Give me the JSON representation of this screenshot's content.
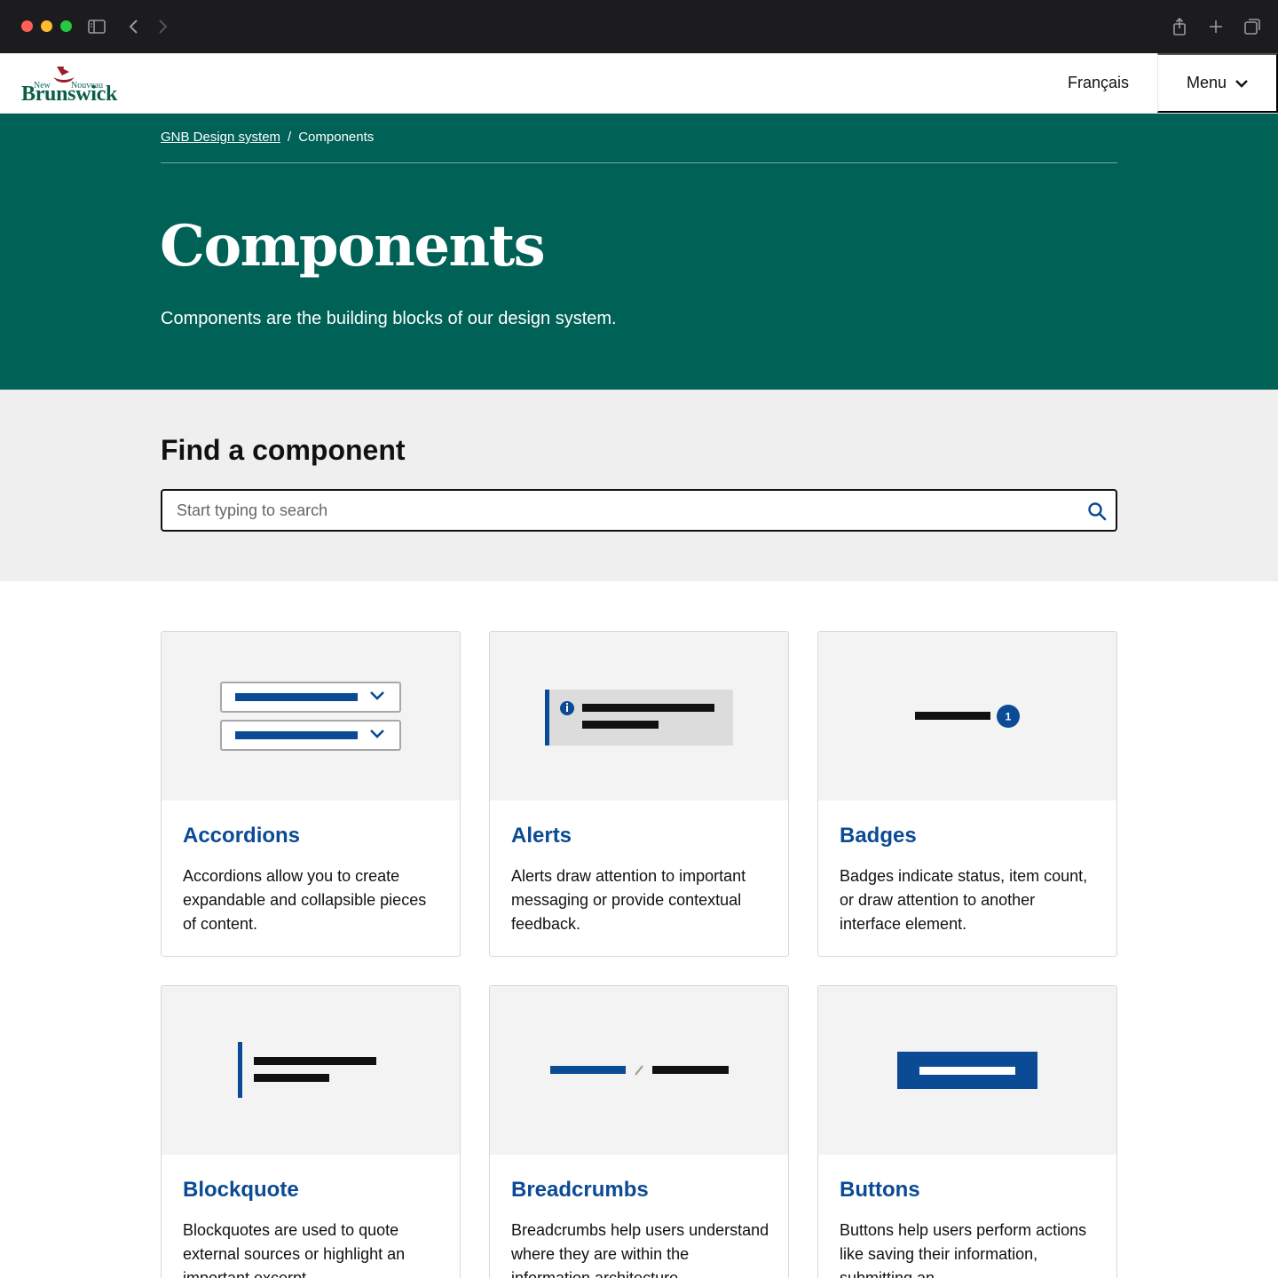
{
  "header": {
    "logo_new": "New",
    "logo_nouveau": "Nouveau",
    "logo_name": "Brunswick",
    "language_link": "Français",
    "menu_label": "Menu"
  },
  "breadcrumb": {
    "home": "GNB Design system",
    "separator": "/",
    "current": "Components"
  },
  "hero": {
    "title": "Components",
    "lead": "Components are the building blocks of our design system."
  },
  "search": {
    "heading": "Find a component",
    "placeholder": "Start typing to search"
  },
  "cards": [
    {
      "title": "Accordions",
      "description": "Accordions allow you to create expandable and collapsible pieces of content."
    },
    {
      "title": "Alerts",
      "description": "Alerts draw attention to important messaging or provide contextual feedback."
    },
    {
      "title": "Badges",
      "description": "Badges indicate status, item count, or draw attention to another interface element."
    },
    {
      "title": "Blockquote",
      "description": "Blockquotes are used to quote external sources or highlight an important excerpt."
    },
    {
      "title": "Breadcrumbs",
      "description": "Breadcrumbs help users understand where they are within the information architecture."
    },
    {
      "title": "Buttons",
      "description": "Buttons help users perform actions like saving their information, submitting an"
    }
  ],
  "badge_count": "1",
  "colors": {
    "hero_bg": "#006156",
    "link_blue": "#0b4a94",
    "accent_blue": "#0b4a94",
    "search_bg": "#efefef",
    "chrome_bg": "#1c1c1e"
  }
}
